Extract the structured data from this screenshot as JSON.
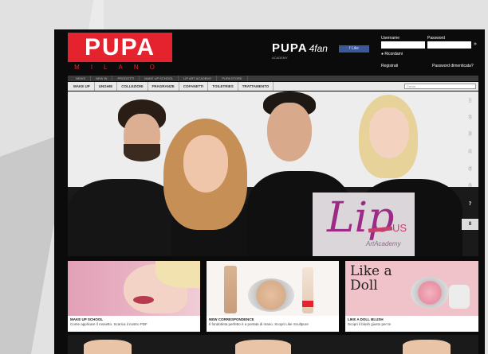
{
  "header": {
    "logo_text": "PUPA",
    "logo_sub": "MILANO",
    "brand2_text": "PUPA",
    "brand2_script": "4fan",
    "brand2_sub": "ACADEMY",
    "facebook_label": "f Like",
    "login": {
      "username_label": "Username",
      "password_label": "Password",
      "submit_label": "»",
      "remember_label": "● Ricordami",
      "register_label": "Registrati",
      "forgot_label": "Password dimenticata?"
    }
  },
  "nav_top": [
    "NEWS",
    "NEW IN",
    "PRODOTTI",
    "MAKE UP SCHOOL",
    "LIP ART ACADEMY",
    "PUPA STORE"
  ],
  "nav_main": [
    "MAKE UP",
    "UNGHIE",
    "COLLEZIONI",
    "FRAGRANZE",
    "COFANETTI",
    "TOILETRIES",
    "TRATTAMENTO"
  ],
  "search": {
    "placeholder": "Cerca"
  },
  "hero": {
    "slide_numbers": [
      "1",
      "2",
      "3",
      "4",
      "5",
      "6",
      "7",
      "8"
    ],
    "active_slide": 8,
    "promo": {
      "script": "Lip",
      "suffix": "US",
      "subtitle": "ArtAcademy"
    }
  },
  "cards": [
    {
      "title": "MAKE UP SCHOOL",
      "subtitle": "Come applicare il rossetto. Scarica il nostro PDF"
    },
    {
      "title": "NEW CORRESPONDENCE",
      "subtitle": "Il fondotinta perfetto è a portata di mano. Scopri Like Scultpure"
    },
    {
      "title": "LIKE A DOLL BLUSH",
      "subtitle": "Scopri il blush giusto per te",
      "headline": "Like a Doll"
    }
  ],
  "colors": {
    "brand_red": "#e4232e",
    "promo_purple": "#9d2b86",
    "promo_pink": "#c83f6b",
    "facebook_blue": "#3b5998"
  }
}
